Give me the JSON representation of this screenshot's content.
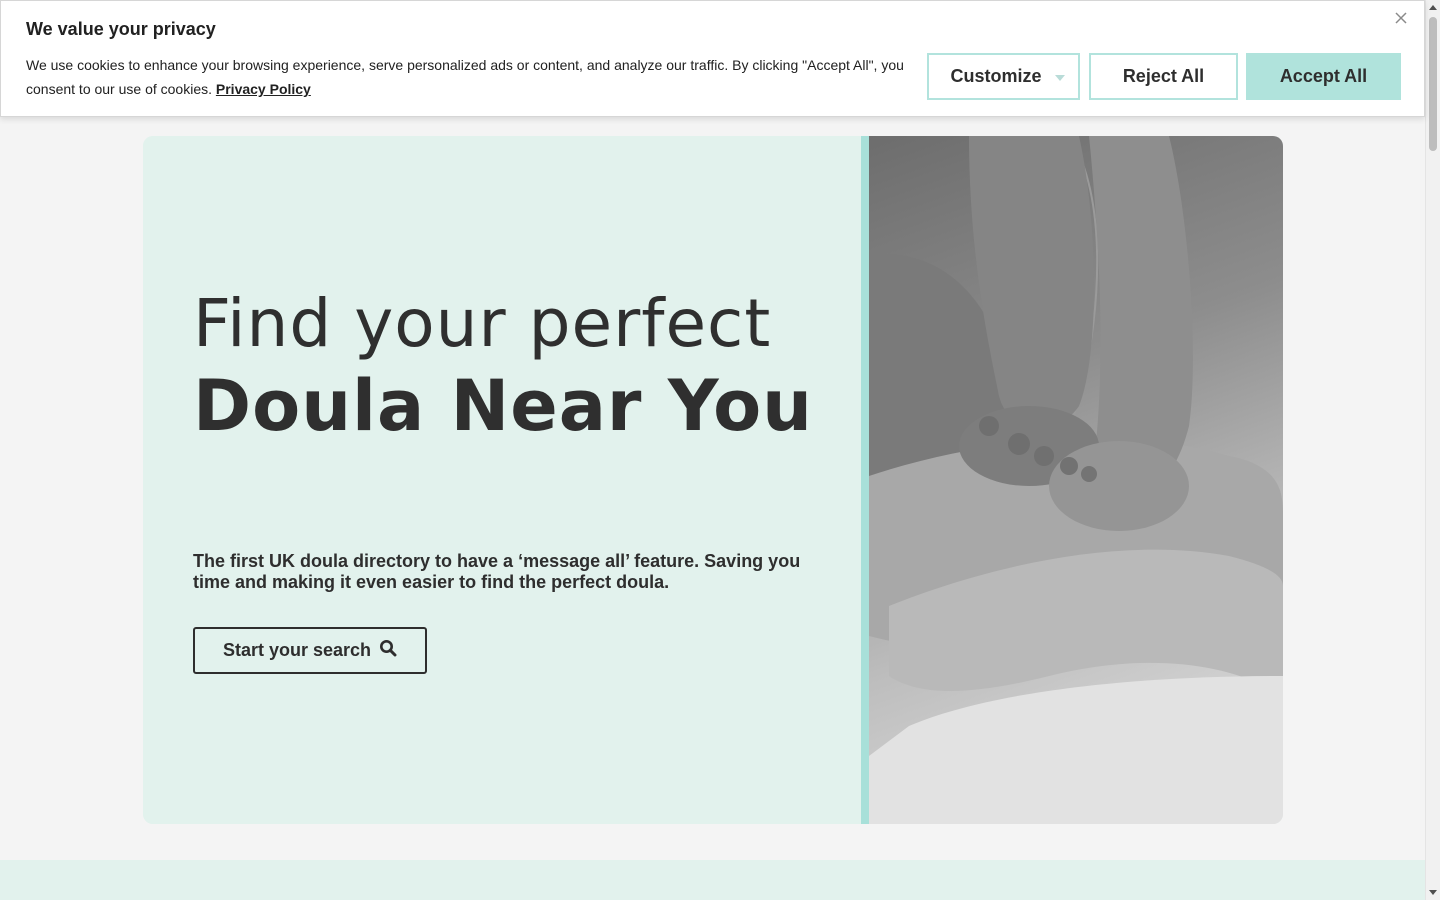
{
  "cookie_banner": {
    "title": "We value your privacy",
    "text": "We use cookies to enhance your browsing experience, serve personalized ads or content, and analyze our traffic. By clicking \"Accept All\", you consent to our use of cookies.",
    "privacy_link": "Privacy Policy",
    "buttons": {
      "customize": "Customize",
      "reject": "Reject All",
      "accept": "Accept All"
    },
    "close_icon": "close-icon"
  },
  "hero": {
    "heading_light": "Find your perfect",
    "heading_bold": "Doula Near You",
    "subheading": "The first UK doula directory to have a ‘message all’ feature. Saving you time and making it even easier to find the perfect doula.",
    "search_button": "Start your search",
    "search_icon": "search-icon",
    "image_alt": "baby-feet-photo"
  },
  "colors": {
    "accent": "#b0e3dc",
    "hero_bg": "#e2f2ed",
    "text": "#2e2e2e"
  }
}
